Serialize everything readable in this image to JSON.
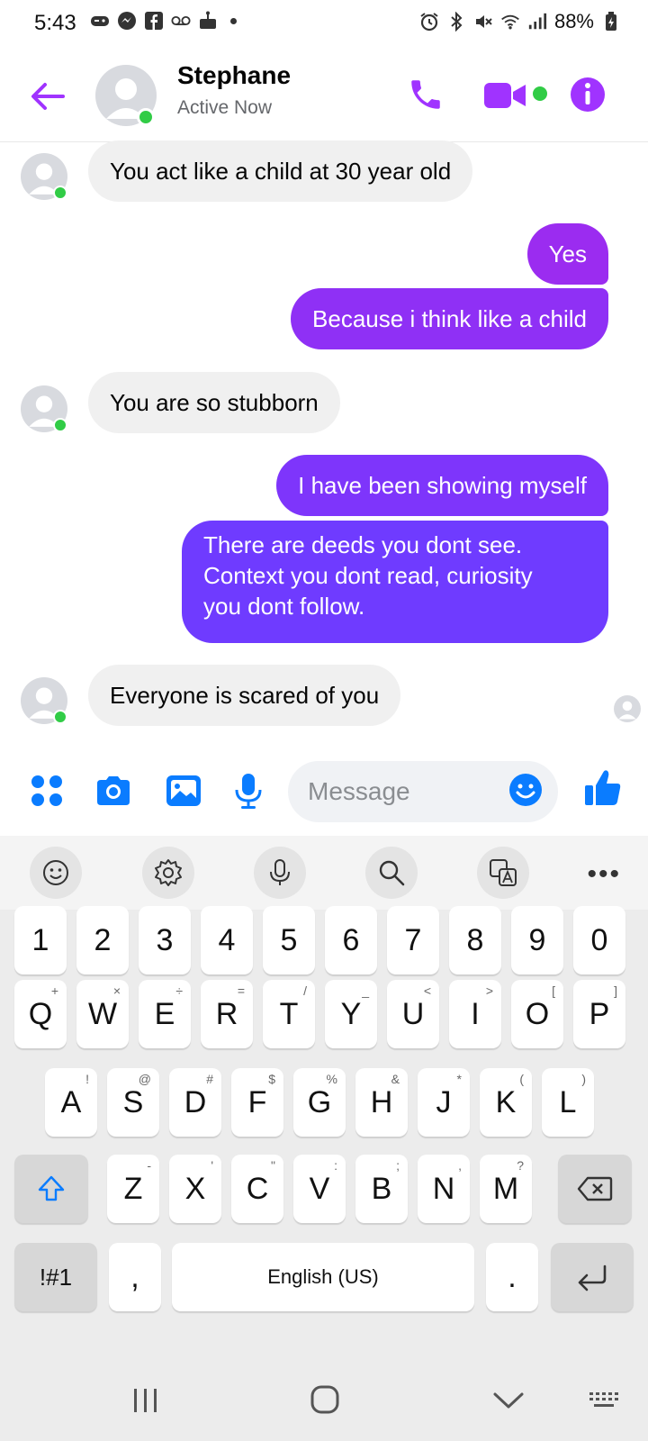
{
  "status_bar": {
    "time": "5:43",
    "battery": "88%",
    "left_icons": [
      "game-icon",
      "messenger-icon",
      "facebook-icon",
      "voicemail-icon",
      "cake-icon",
      "dot-icon"
    ],
    "right_icons": [
      "alarm-icon",
      "bluetooth-icon",
      "mute-icon",
      "wifi-icon",
      "signal-icon",
      "battery-icon"
    ]
  },
  "header": {
    "name": "Stephane",
    "status": "Active Now"
  },
  "messages": [
    {
      "dir": "in",
      "text": "You act like a child at 30 year old"
    },
    {
      "dir": "out",
      "text": "Yes"
    },
    {
      "dir": "out",
      "text": "Because i think like a child"
    },
    {
      "dir": "in",
      "text": "You are so stubborn"
    },
    {
      "dir": "out",
      "text": "I have been showing myself"
    },
    {
      "dir": "out",
      "lines": [
        "There are deeds you dont see.",
        "Context you dont read, curiosity",
        "you dont follow."
      ]
    },
    {
      "dir": "in",
      "text": "Everyone is scared of you"
    }
  ],
  "composer": {
    "placeholder": "Message"
  },
  "keyboard": {
    "row_numbers": [
      "1",
      "2",
      "3",
      "4",
      "5",
      "6",
      "7",
      "8",
      "9",
      "0"
    ],
    "row_q": [
      [
        "Q",
        "+"
      ],
      [
        "W",
        "×"
      ],
      [
        "E",
        "÷"
      ],
      [
        "R",
        "="
      ],
      [
        "T",
        "/"
      ],
      [
        "Y",
        "_"
      ],
      [
        "U",
        "<"
      ],
      [
        "I",
        ">"
      ],
      [
        "O",
        "["
      ],
      [
        "P",
        "]"
      ]
    ],
    "row_a": [
      [
        "A",
        "!"
      ],
      [
        "S",
        "@"
      ],
      [
        "D",
        "#"
      ],
      [
        "F",
        "$"
      ],
      [
        "G",
        "%"
      ],
      [
        "H",
        "&"
      ],
      [
        "J",
        "*"
      ],
      [
        "K",
        "("
      ],
      [
        "L",
        ")"
      ]
    ],
    "row_z": [
      [
        "Z",
        "-"
      ],
      [
        "X",
        "'"
      ],
      [
        "C",
        "\""
      ],
      [
        "V",
        ":"
      ],
      [
        "B",
        ";"
      ],
      [
        "N",
        ","
      ],
      [
        "M",
        "?"
      ]
    ],
    "symbols_key": "!#1",
    "comma_key": ",",
    "space_label": "English (US)",
    "period_key": "."
  },
  "colors": {
    "accent": "#a033ff",
    "bubble_out_top": "#9b2cf0",
    "bubble_out_bottom": "#6f3bff",
    "bubble_in": "#f0f0f0",
    "composer_icons": "#0a7cff",
    "presence": "#31cc46"
  }
}
